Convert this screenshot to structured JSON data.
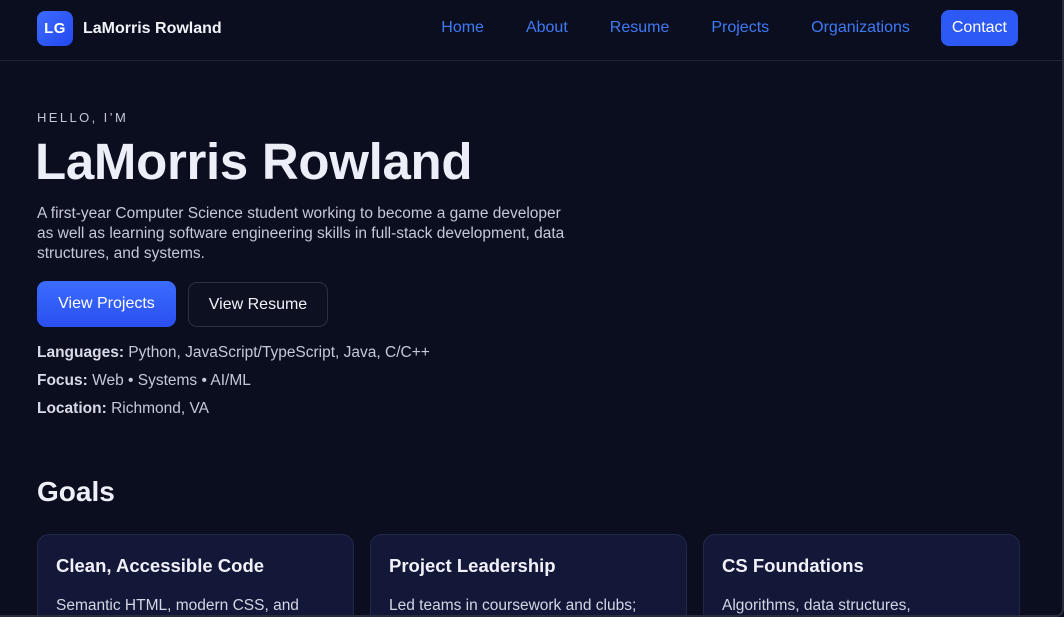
{
  "brand": {
    "logo_text": "LG",
    "name": "LaMorris Rowland"
  },
  "nav": {
    "links": [
      "Home",
      "About",
      "Resume",
      "Projects",
      "Organizations"
    ],
    "contact_label": "Contact"
  },
  "hero": {
    "eyebrow": "HELLO, I’M",
    "title": "LaMorris Rowland",
    "description": "A first-year Computer Science student working to become a game developer as well as learning software engineering skills in full-stack development, data structures, and systems.",
    "primary_button": "View Projects",
    "secondary_button": "View Resume",
    "facts": [
      {
        "label": "Languages:",
        "value": "Python, JavaScript/TypeScript, Java, C/C++"
      },
      {
        "label": "Focus:",
        "value": "Web • Systems • AI/ML"
      },
      {
        "label": "Location:",
        "value": "Richmond, VA"
      }
    ]
  },
  "goals": {
    "heading": "Goals",
    "cards": [
      {
        "title": "Clean, Accessible Code",
        "body": "Semantic HTML, modern CSS, and"
      },
      {
        "title": "Project Leadership",
        "body": "Led teams in coursework and clubs;"
      },
      {
        "title": "CS Foundations",
        "body": "Algorithms, data structures,"
      }
    ]
  },
  "colors": {
    "background": "#0b0e1f",
    "accent": "#2d59f5",
    "link": "#3f7af5",
    "card": "#131738"
  }
}
